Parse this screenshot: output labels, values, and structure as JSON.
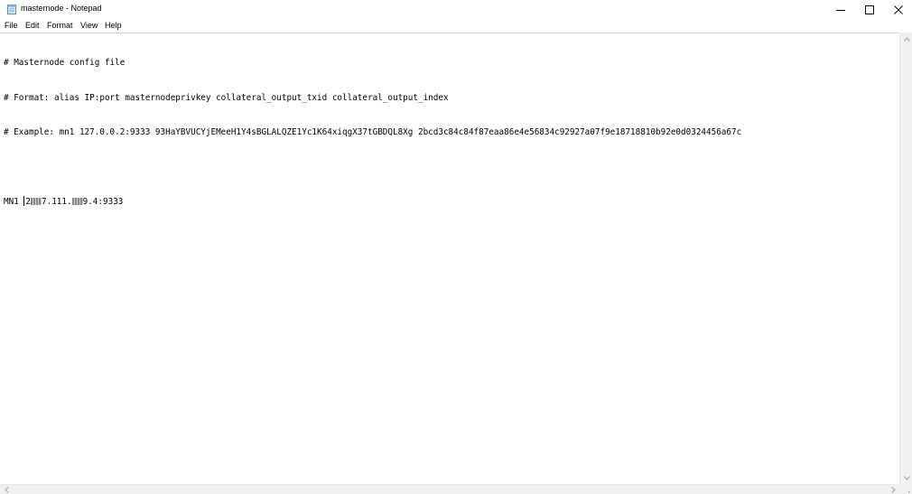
{
  "window": {
    "title": "masternode - Notepad",
    "icons": {
      "app": "notepad-icon",
      "minimize": "minimize-icon",
      "maximize": "maximize-icon",
      "close": "close-icon"
    }
  },
  "menu": {
    "items": [
      {
        "label": "File"
      },
      {
        "label": "Edit"
      },
      {
        "label": "Format"
      },
      {
        "label": "View"
      },
      {
        "label": "Help"
      }
    ]
  },
  "editor": {
    "lines": [
      "# Masternode config file",
      "# Format: alias IP:port masternodeprivkey collateral_output_txid collateral_output_index",
      "# Example: mn1 127.0.0.2:9333 93HaYBVUCYjEMeeH1Y4sBGLALQZE1Yc1K64xiqgX37tGBDQL8Xg 2bcd3c84c84f87eaa86e4e56834c92927a07f9e18718810b92e0d0324456a67c",
      ""
    ],
    "entry": {
      "alias": "MN1",
      "ip_part_1": "2",
      "ip_part_2": "7.111.",
      "ip_part_3": "9.4:9333"
    }
  },
  "scrollbars": {
    "icons": {
      "up": "scroll-up-arrow-icon",
      "down": "scroll-down-arrow-icon",
      "left": "scroll-left-arrow-icon",
      "right": "scroll-right-arrow-icon",
      "grip": "resize-grip-icon"
    }
  },
  "colors": {
    "background": "#ffffff",
    "text": "#000000",
    "scrollbar": "#f0f0f0",
    "arrow": "#a0a0a0"
  }
}
